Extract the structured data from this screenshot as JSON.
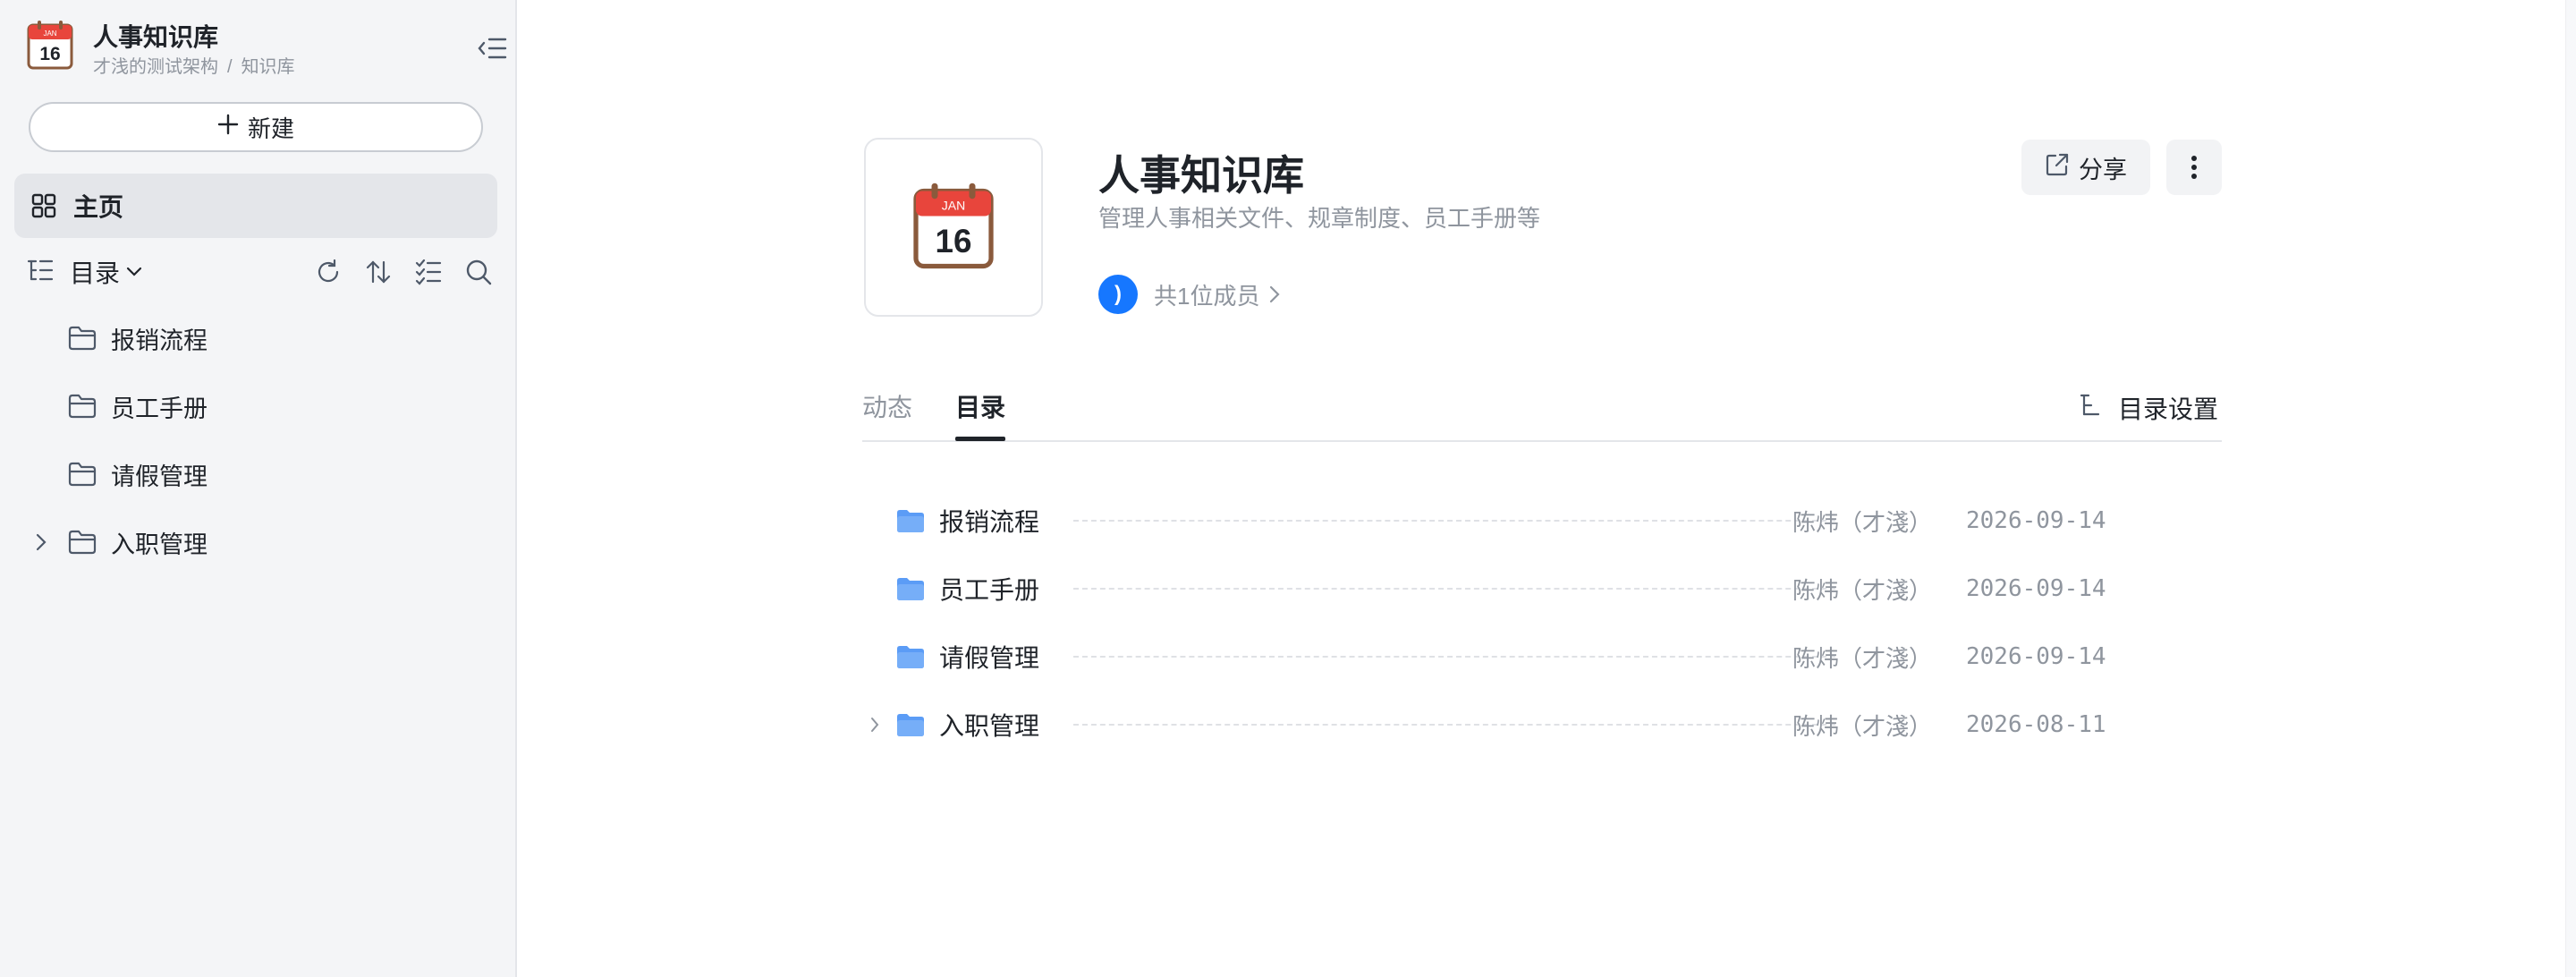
{
  "sidebar": {
    "kb_title": "人事知识库",
    "breadcrumb": [
      "才浅的测试架构",
      "知识库"
    ],
    "breadcrumb_sep": "/",
    "new_button": "新建",
    "home_label": "主页",
    "directory_label": "目录",
    "tree": [
      {
        "label": "报销流程",
        "expandable": false
      },
      {
        "label": "员工手册",
        "expandable": false
      },
      {
        "label": "请假管理",
        "expandable": false
      },
      {
        "label": "入职管理",
        "expandable": true
      }
    ]
  },
  "calendar_icon": {
    "month": "JAN",
    "day": "16"
  },
  "main": {
    "title": "人事知识库",
    "description": "管理人事相关文件、规章制度、员工手册等",
    "avatar_char": ")",
    "members_text": "共1位成员",
    "share_label": "分享",
    "tabs": [
      {
        "label": "动态",
        "active": false
      },
      {
        "label": "目录",
        "active": true
      }
    ],
    "dir_settings_label": "目录设置",
    "rows": [
      {
        "name": "报销流程",
        "owner": "陈炜（才淺）",
        "date": "2026-09-14",
        "expandable": false
      },
      {
        "name": "员工手册",
        "owner": "陈炜（才淺）",
        "date": "2026-09-14",
        "expandable": false
      },
      {
        "name": "请假管理",
        "owner": "陈炜（才淺）",
        "date": "2026-09-14",
        "expandable": false
      },
      {
        "name": "入职管理",
        "owner": "陈炜（才淺）",
        "date": "2026-08-11",
        "expandable": true
      }
    ]
  },
  "colors": {
    "accent": "#1677ff",
    "folder": "#5b9cf6",
    "sidebar_bg": "#f4f5f7",
    "muted_text": "#8f959e"
  }
}
